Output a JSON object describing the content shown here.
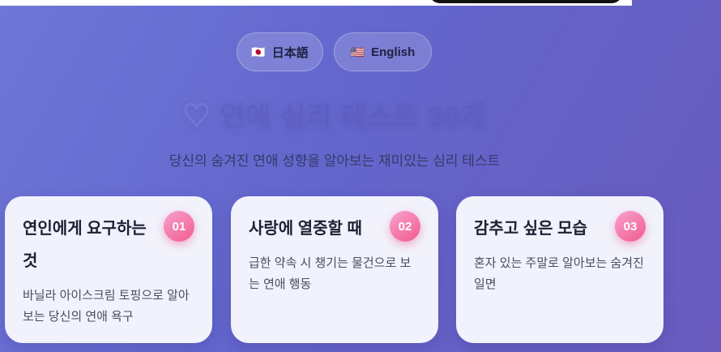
{
  "languages": [
    {
      "flag": "🇯🇵",
      "label": "日本語"
    },
    {
      "flag": "🇺🇸",
      "label": "English"
    }
  ],
  "header": {
    "heart": "♡",
    "title": "연애 심리 테스트 30개",
    "subtitle": "당신의 숨겨진 연애 성향을 알아보는 재미있는 심리 테스트"
  },
  "tests": [
    {
      "number": "01",
      "title": "연인에게 요구하는 것",
      "description": "바닐라 아이스크림 토핑으로 알아보는 당신의 연애 욕구"
    },
    {
      "number": "02",
      "title": "사랑에 열중할 때",
      "description": "급한 약속 시 챙기는 물건으로 보는 연애 행동"
    },
    {
      "number": "03",
      "title": "감추고 싶은 모습",
      "description": "혼자 있는 주말로 알아보는 숨겨진 일면"
    }
  ]
}
